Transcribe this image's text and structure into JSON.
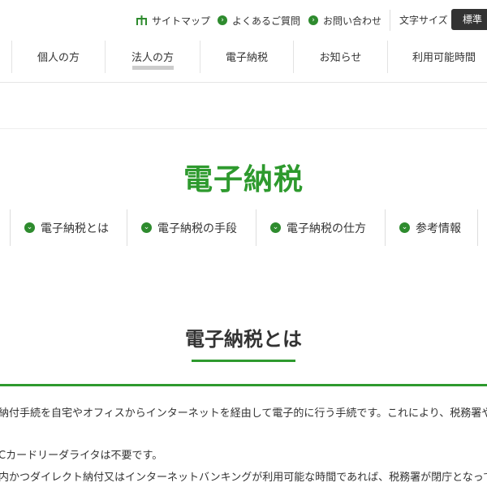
{
  "utility_nav": {
    "sitemap": "サイトマップ",
    "faq": "よくあるご質問",
    "contact": "お問い合わせ",
    "font_size_label": "文字サイズ",
    "font_size_current": "標準"
  },
  "global_nav": [
    {
      "label": "個人の方"
    },
    {
      "label": "法人の方",
      "active": true
    },
    {
      "label": "電子納税"
    },
    {
      "label": "お知らせ"
    },
    {
      "label": "利用可能時間"
    }
  ],
  "page": {
    "title": "電子納税"
  },
  "page_nav": [
    {
      "label": "電子納税とは"
    },
    {
      "label": "電子納税の手段"
    },
    {
      "label": "電子納税の仕方"
    },
    {
      "label": "参考情報"
    }
  ],
  "section": {
    "title": "電子納税とは",
    "paragraphs": [
      "納付手続を自宅やオフィスからインターネットを経由して電子的に行う手続です。これにより、税務署や金",
      "Cカードリーダライタは不要です。",
      "内かつダイレクト納付又はインターネットバンキングが利用可能な時間であれば、税務署が閉庁となって"
    ]
  },
  "colors": {
    "accent_green": "#2e9a2e",
    "icon_green": "#2e8b2e",
    "font_size_button": "#333333"
  },
  "icons": {
    "sitemap": "sitemap-icon",
    "bullet": "circle-chevron-icon"
  }
}
